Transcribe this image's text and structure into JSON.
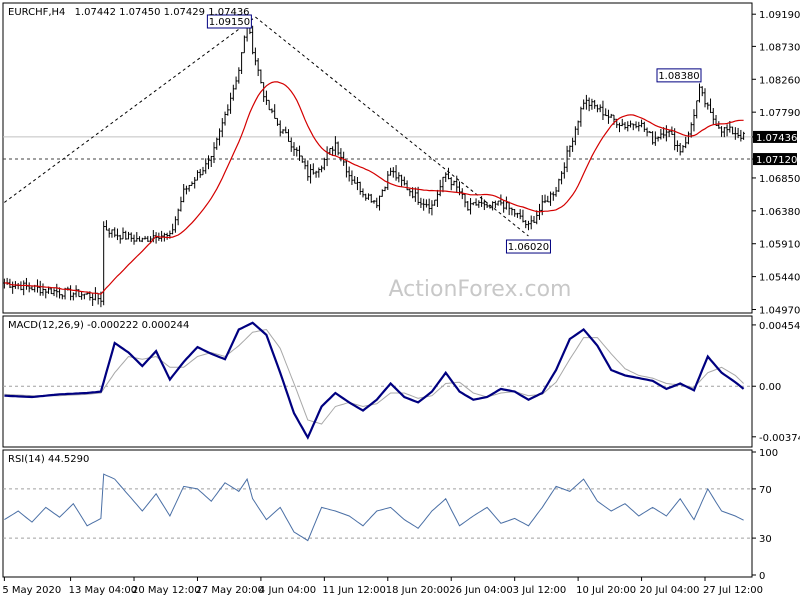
{
  "chart_data": [
    {
      "type": "candlestick",
      "title": "EURCHF,H4",
      "ohlc_header": "1.07442 1.07450 1.07429 1.07436",
      "watermark": "ActionForex.com",
      "ylim": [
        1.0492,
        1.0935
      ],
      "y_ticks": [
        "1.09190",
        "1.08730",
        "1.08260",
        "1.07790",
        "1.07436",
        "1.07120",
        "1.06850",
        "1.06380",
        "1.05910",
        "1.05440",
        "1.04970"
      ],
      "y_tick_values": [
        1.0919,
        1.0873,
        1.0826,
        1.0779,
        1.07436,
        1.0712,
        1.0685,
        1.0638,
        1.0591,
        1.0544,
        1.0497
      ],
      "highlight_tags": [
        "1.07436",
        "1.07120"
      ],
      "x_labels": [
        "5 May 2020",
        "13 May 04:00",
        "20 May 12:00",
        "27 May 20:00",
        "4 Jun 04:00",
        "11 Jun 12:00",
        "18 Jun 20:00",
        "26 Jun 04:00",
        "3 Jul 12:00",
        "10 Jul 20:00",
        "20 Jul 04:00",
        "27 Jul 12:00"
      ],
      "x_label_index": [
        0,
        24,
        47,
        70,
        93,
        116,
        139,
        162,
        185,
        208,
        231,
        254
      ],
      "bar_count": 269,
      "price_path": {
        "index": [
          0,
          10,
          20,
          30,
          35,
          36,
          40,
          50,
          55,
          60,
          65,
          70,
          75,
          80,
          85,
          88,
          90,
          95,
          100,
          105,
          110,
          115,
          120,
          125,
          130,
          135,
          140,
          145,
          150,
          155,
          160,
          165,
          168,
          172,
          175,
          180,
          185,
          190,
          195,
          200,
          205,
          210,
          215,
          220,
          225,
          230,
          235,
          240,
          245,
          248,
          252,
          256,
          260,
          265,
          268
        ],
        "close": [
          1.0535,
          1.0528,
          1.0522,
          1.0518,
          1.0512,
          1.0615,
          1.0605,
          1.0595,
          1.0605,
          1.06,
          1.0665,
          1.069,
          1.071,
          1.0775,
          1.084,
          1.0905,
          1.087,
          1.079,
          1.0755,
          1.073,
          1.069,
          1.0705,
          1.0735,
          1.069,
          1.0665,
          1.065,
          1.0695,
          1.0675,
          1.0655,
          1.0645,
          1.069,
          1.0665,
          1.064,
          1.065,
          1.064,
          1.065,
          1.0635,
          1.0615,
          1.0645,
          1.067,
          1.073,
          1.0795,
          1.0785,
          1.077,
          1.076,
          1.0765,
          1.074,
          1.0755,
          1.0725,
          1.0745,
          1.081,
          1.0775,
          1.0755,
          1.075,
          1.07436
        ]
      },
      "series": [
        {
          "kind": "price",
          "color": "#000000"
        },
        {
          "kind": "moving-average",
          "color": "#d40000"
        }
      ],
      "annotations": [
        {
          "text": "1.09150",
          "index": 91,
          "value": 1.0915
        },
        {
          "text": "1.06020",
          "index": 190,
          "value": 1.0602
        },
        {
          "text": "1.08380",
          "index": 254,
          "value": 1.0838
        }
      ],
      "trendlines": [
        {
          "from_index": 0,
          "from_value": 1.065,
          "to_index": 91,
          "to_value": 1.0915
        },
        {
          "from_index": 91,
          "from_value": 1.0915,
          "to_index": 190,
          "to_value": 1.0602
        }
      ],
      "hlines": [
        {
          "value": 1.07436,
          "style": "solid",
          "color": "#c0c0c0"
        },
        {
          "value": 1.0712,
          "style": "dashed",
          "color": "#404040"
        }
      ]
    },
    {
      "type": "line",
      "title": "MACD(12,26,9) -0.000222 0.000244",
      "ylim": [
        -0.0045,
        0.0052
      ],
      "y_ticks": [
        "0.00454",
        "0.00",
        "-0.003745"
      ],
      "y_tick_values": [
        0.00454,
        0.0,
        -0.003745
      ],
      "zero_line": 0.0,
      "series": [
        {
          "kind": "macd",
          "color": "#000080",
          "index": [
            0,
            10,
            20,
            30,
            35,
            40,
            45,
            50,
            55,
            60,
            65,
            70,
            75,
            80,
            85,
            90,
            95,
            100,
            105,
            110,
            115,
            120,
            125,
            130,
            135,
            140,
            145,
            150,
            155,
            160,
            165,
            170,
            175,
            180,
            185,
            190,
            195,
            200,
            205,
            210,
            215,
            220,
            225,
            230,
            235,
            240,
            245,
            250,
            255,
            260,
            265,
            268
          ],
          "value": [
            -0.0007,
            -0.0008,
            -0.0006,
            -0.0005,
            -0.0004,
            0.0032,
            0.0025,
            0.0015,
            0.0026,
            0.0005,
            0.0018,
            0.0029,
            0.0024,
            0.002,
            0.0042,
            0.0047,
            0.0038,
            0.001,
            -0.002,
            -0.0038,
            -0.0015,
            -0.0005,
            -0.0012,
            -0.0018,
            -0.001,
            0.0002,
            -0.0008,
            -0.0012,
            -0.0004,
            0.001,
            -0.0004,
            -0.001,
            -0.0008,
            -0.0002,
            -0.0004,
            -0.001,
            -0.0005,
            0.0012,
            0.0035,
            0.0042,
            0.003,
            0.0012,
            0.0008,
            0.0006,
            0.0004,
            -0.0002,
            0.0002,
            -0.0003,
            0.0022,
            0.001,
            0.0003,
            -0.0002
          ]
        },
        {
          "kind": "signal",
          "color": "#a8a8a8",
          "index": [
            0,
            10,
            20,
            30,
            35,
            40,
            45,
            50,
            55,
            60,
            65,
            70,
            75,
            80,
            85,
            90,
            95,
            100,
            105,
            110,
            115,
            120,
            125,
            130,
            135,
            140,
            145,
            150,
            155,
            160,
            165,
            170,
            175,
            180,
            185,
            190,
            195,
            200,
            205,
            210,
            215,
            220,
            225,
            230,
            235,
            240,
            245,
            250,
            255,
            260,
            265,
            268
          ],
          "value": [
            -0.0006,
            -0.0007,
            -0.0007,
            -0.0006,
            -0.0005,
            0.001,
            0.0022,
            0.002,
            0.0022,
            0.0014,
            0.0014,
            0.0022,
            0.0025,
            0.0022,
            0.003,
            0.004,
            0.0042,
            0.0028,
            0.0002,
            -0.0025,
            -0.0028,
            -0.0015,
            -0.0012,
            -0.0015,
            -0.0013,
            -0.0005,
            -0.0005,
            -0.0009,
            -0.0007,
            0.0002,
            0.0003,
            -0.0005,
            -0.0008,
            -0.0005,
            -0.0004,
            -0.0007,
            -0.0006,
            0.0003,
            0.002,
            0.0036,
            0.0036,
            0.0024,
            0.0013,
            0.0008,
            0.0006,
            0.0002,
            0.0001,
            -0.0001,
            0.001,
            0.0014,
            0.0008,
            0.0002
          ]
        }
      ]
    },
    {
      "type": "line",
      "title": "RSI(14) 44.5290",
      "ylim": [
        0,
        100
      ],
      "y_ticks": [
        "100",
        "70",
        "30",
        "0"
      ],
      "y_tick_values": [
        100,
        70,
        30,
        0
      ],
      "levels": [
        70,
        30
      ],
      "series": [
        {
          "kind": "rsi",
          "color": "#4a6fa5",
          "index": [
            0,
            5,
            10,
            15,
            20,
            25,
            30,
            35,
            36,
            40,
            45,
            50,
            55,
            60,
            65,
            70,
            75,
            80,
            85,
            88,
            90,
            95,
            100,
            105,
            110,
            115,
            120,
            125,
            130,
            135,
            140,
            145,
            150,
            155,
            160,
            165,
            170,
            175,
            180,
            185,
            190,
            195,
            200,
            205,
            210,
            215,
            220,
            225,
            230,
            235,
            240,
            245,
            250,
            255,
            260,
            265,
            268
          ],
          "value": [
            45,
            52,
            43,
            55,
            47,
            58,
            40,
            46,
            82,
            78,
            65,
            52,
            66,
            48,
            72,
            70,
            60,
            75,
            68,
            78,
            62,
            45,
            55,
            35,
            28,
            55,
            52,
            48,
            40,
            52,
            55,
            45,
            38,
            52,
            62,
            40,
            48,
            55,
            42,
            46,
            40,
            55,
            72,
            68,
            78,
            60,
            52,
            58,
            48,
            55,
            48,
            62,
            45,
            70,
            52,
            48,
            44.529
          ]
        }
      ]
    }
  ]
}
